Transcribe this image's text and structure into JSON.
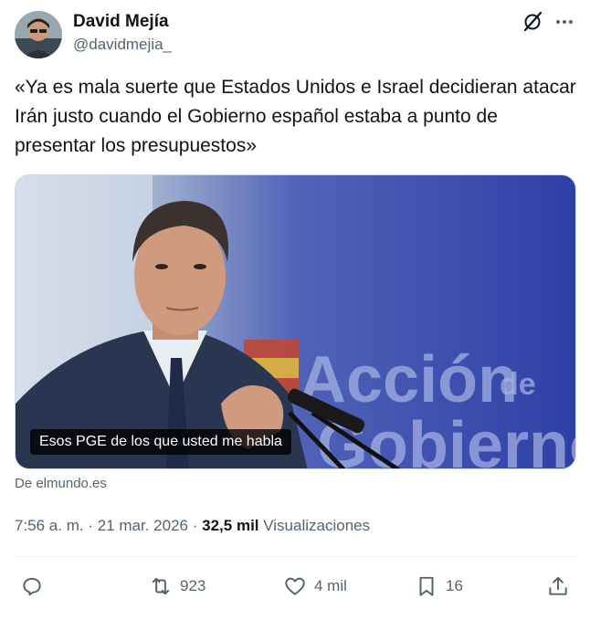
{
  "author": {
    "name": "David Mejía",
    "handle": "@davidmejia_"
  },
  "tweet": {
    "text": "«Ya es mala suerte que Estados Unidos e Israel decidieran atacar Irán justo cuando el Gobierno español estaba a punto de presentar los presupuestos»"
  },
  "media": {
    "caption": "Esos PGE de los que usted me habla",
    "source": "De elmundo.es",
    "background_text": [
      "Acción",
      "de",
      "Gobierno"
    ]
  },
  "meta": {
    "time": "7:56 a. m.",
    "separator": "·",
    "date": "21 mar. 2026",
    "views_count": "32,5 mil",
    "views_label": "Visualizaciones"
  },
  "actions": {
    "reply_count": "",
    "retweet_count": "923",
    "like_count": "4 mil",
    "bookmark_count": "16"
  },
  "icons": {
    "grok": "grok-icon",
    "more": "more-icon",
    "reply": "reply-icon",
    "retweet": "retweet-icon",
    "like": "heart-icon",
    "bookmark": "bookmark-icon",
    "share": "share-icon"
  },
  "colors": {
    "text_primary": "#0f1419",
    "text_secondary": "#536471",
    "border": "#cfd9de",
    "divider": "#eff3f4"
  }
}
